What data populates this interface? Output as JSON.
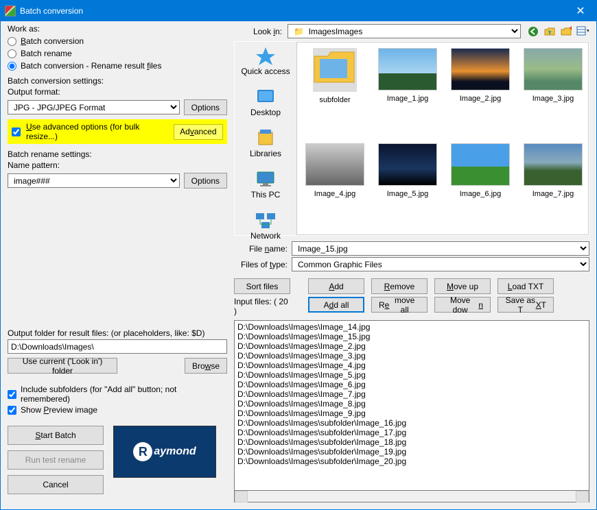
{
  "window": {
    "title": "Batch conversion"
  },
  "work_as": {
    "label": "Work as:",
    "opt1": "Batch conversion",
    "opt2": "Batch rename",
    "opt3": "Batch conversion - Rename result files",
    "selected": 3
  },
  "conv_settings": {
    "label": "Batch conversion settings:",
    "output_format_label": "Output format:",
    "output_format_value": "JPG - JPG/JPEG Format",
    "options_btn": "Options",
    "adv_checkbox": "Use advanced options (for bulk resize...)",
    "advanced_btn": "Advanced"
  },
  "rename_settings": {
    "label": "Batch rename settings:",
    "pattern_label": "Name pattern:",
    "pattern_value": "image###",
    "options_btn": "Options"
  },
  "output_folder": {
    "label": "Output folder for result files: (or placeholders, like: $D)",
    "value": "D:\\Downloads\\Images\\",
    "use_current_btn": "Use current ('Look in') folder",
    "browse_btn": "Browse"
  },
  "options": {
    "include_subfolders": "Include subfolders (for \"Add all\" button; not remembered)",
    "show_preview": "Show Preview image"
  },
  "main_buttons": {
    "start": "Start Batch",
    "test": "Run test rename",
    "cancel": "Cancel"
  },
  "lookin": {
    "label": "Look in:",
    "value": "Images"
  },
  "places": {
    "quick": "Quick access",
    "desktop": "Desktop",
    "libraries": "Libraries",
    "thispc": "This PC",
    "network": "Network"
  },
  "thumbs": [
    {
      "name": "subfolder",
      "type": "folder"
    },
    {
      "name": "Image_1.jpg",
      "type": "img",
      "bg": "linear-gradient(#6db3e8,#a8d4f0 60%,#2a5a30 60%)"
    },
    {
      "name": "Image_2.jpg",
      "type": "img",
      "bg": "linear-gradient(#1a2a50,#e89030 55%,#0a1020 80%)"
    },
    {
      "name": "Image_3.jpg",
      "type": "img",
      "bg": "linear-gradient(#8aa,#9b8 50%,#586 80%)"
    },
    {
      "name": "Image_4.jpg",
      "type": "img",
      "bg": "linear-gradient(#ccc,#999 50%,#666)"
    },
    {
      "name": "Image_5.jpg",
      "type": "img",
      "bg": "linear-gradient(#0a1530,#1a3560 60%,#000)"
    },
    {
      "name": "Image_6.jpg",
      "type": "img",
      "bg": "linear-gradient(#4aa0e8,#4aa0e8 55%,#3a9030 55%)"
    },
    {
      "name": "Image_7.jpg",
      "type": "img",
      "bg": "linear-gradient(#5a8bc0,#8ab 45%,#3a6030 65%)"
    }
  ],
  "file_fields": {
    "name_label": "File name:",
    "name_value": "Image_15.jpg",
    "type_label": "Files of type:",
    "type_value": "Common Graphic Files"
  },
  "actions": {
    "sort": "Sort files",
    "add": "Add",
    "remove": "Remove",
    "moveup": "Move up",
    "loadtxt": "Load TXT",
    "addall": "Add all",
    "removeall": "Remove all",
    "movedown": "Move down",
    "savetxt": "Save as TXT"
  },
  "input_files_label": "Input files: ( 20 )",
  "input_files": [
    "D:\\Downloads\\Images\\Image_14.jpg",
    "D:\\Downloads\\Images\\Image_15.jpg",
    "D:\\Downloads\\Images\\Image_2.jpg",
    "D:\\Downloads\\Images\\Image_3.jpg",
    "D:\\Downloads\\Images\\Image_4.jpg",
    "D:\\Downloads\\Images\\Image_5.jpg",
    "D:\\Downloads\\Images\\Image_6.jpg",
    "D:\\Downloads\\Images\\Image_7.jpg",
    "D:\\Downloads\\Images\\Image_8.jpg",
    "D:\\Downloads\\Images\\Image_9.jpg",
    "D:\\Downloads\\Images\\subfolder\\Image_16.jpg",
    "D:\\Downloads\\Images\\subfolder\\Image_17.jpg",
    "D:\\Downloads\\Images\\subfolder\\Image_18.jpg",
    "D:\\Downloads\\Images\\subfolder\\Image_19.jpg",
    "D:\\Downloads\\Images\\subfolder\\Image_20.jpg"
  ]
}
